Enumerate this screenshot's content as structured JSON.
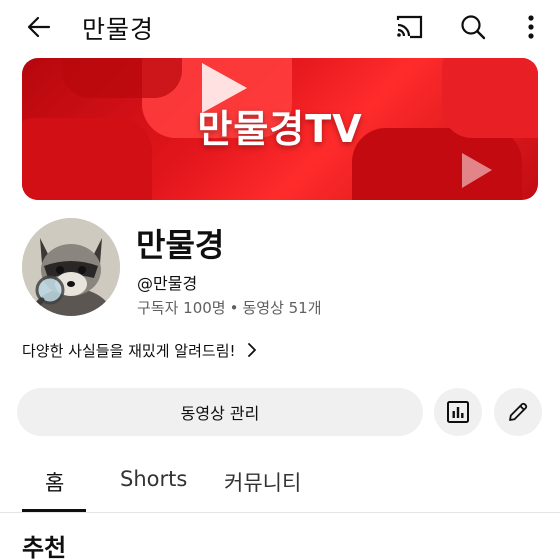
{
  "topbar": {
    "title": "만물경",
    "icons": [
      "arrow-back-icon",
      "cast-icon",
      "search-icon",
      "more-vert-icon"
    ]
  },
  "banner": {
    "text": "만물경TV"
  },
  "channel": {
    "name": "만물경",
    "handle": "@만물경",
    "subscribers": "구독자 100명",
    "separator": "•",
    "videos": "동영상 51개",
    "description": "다양한 사실들을 재밌게 알려드림!"
  },
  "actions": {
    "manage_label": "동영상 관리",
    "icons": [
      "analytics-icon",
      "edit-icon"
    ]
  },
  "tabs": [
    {
      "label": "홈",
      "active": true
    },
    {
      "label": "Shorts",
      "active": false
    },
    {
      "label": "커뮤니티",
      "active": false
    }
  ],
  "section": {
    "title": "추천"
  },
  "colors": {
    "banner_red": "#e2161c",
    "button_bg": "#f0f0f0",
    "text": "#0f0f0f",
    "secondary_text": "#606060"
  }
}
